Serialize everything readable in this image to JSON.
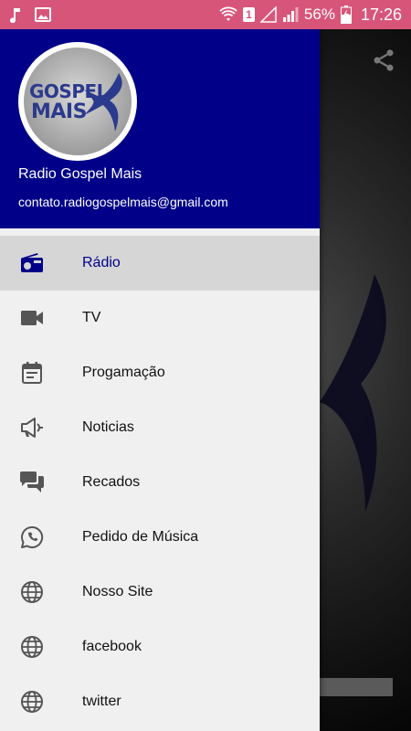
{
  "status_bar": {
    "battery": "56%",
    "time": "17:26",
    "sim": "1",
    "icons": [
      "music-note-icon",
      "image-icon",
      "wifi-icon",
      "sim-icon",
      "signal-empty-icon",
      "signal-icon",
      "battery-charging-icon"
    ]
  },
  "drawer": {
    "header": {
      "logo_text_line1": "GOSPEL",
      "logo_text_line2": "MAIS",
      "name": "Radio Gospel Mais",
      "email": "contato.radiogospelmais@gmail.com",
      "background_color": "#000088"
    },
    "items": [
      {
        "label": "Rádio",
        "icon": "radio-icon",
        "active": true
      },
      {
        "label": "TV",
        "icon": "videocam-icon",
        "active": false
      },
      {
        "label": "Progamação",
        "icon": "calendar-icon",
        "active": false
      },
      {
        "label": "Noticias",
        "icon": "megaphone-icon",
        "active": false
      },
      {
        "label": "Recados",
        "icon": "chat-icon",
        "active": false
      },
      {
        "label": "Pedido de Música",
        "icon": "whatsapp-icon",
        "active": false
      },
      {
        "label": "Nosso Site",
        "icon": "globe-icon",
        "active": false
      },
      {
        "label": "facebook",
        "icon": "globe-icon",
        "active": false
      },
      {
        "label": "twitter",
        "icon": "globe-icon",
        "active": false
      }
    ]
  },
  "app": {
    "share_icon": "share-icon",
    "accent_color": "#d8557a"
  }
}
